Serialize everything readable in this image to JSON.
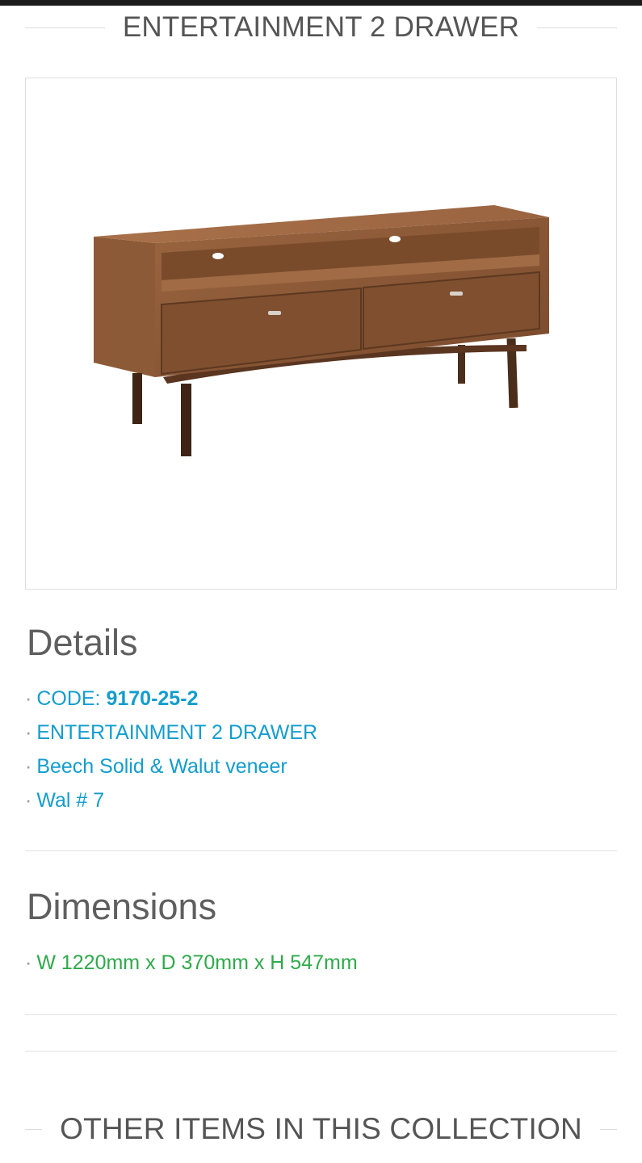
{
  "header": {
    "title": "ENTERTAINMENT 2 DRAWER"
  },
  "product_image": {
    "alt": "Walnut entertainment unit with two drawers and open shelf on tapered legs"
  },
  "details": {
    "heading": "Details",
    "code_label": "CODE: ",
    "code_value": "9170-25-2",
    "items": [
      "ENTERTAINMENT 2 DRAWER",
      "Beech Solid & Walut veneer",
      "Wal # 7"
    ],
    "bullet": "·"
  },
  "dimensions": {
    "heading": "Dimensions",
    "items": [
      "W 1220mm x D 370mm x H 547mm"
    ]
  },
  "collection": {
    "heading": "OTHER ITEMS IN THIS COLLECTION"
  },
  "colors": {
    "link_blue": "#139dce",
    "dimension_green": "#2eaa4a",
    "heading_gray": "#5f5f5f"
  }
}
